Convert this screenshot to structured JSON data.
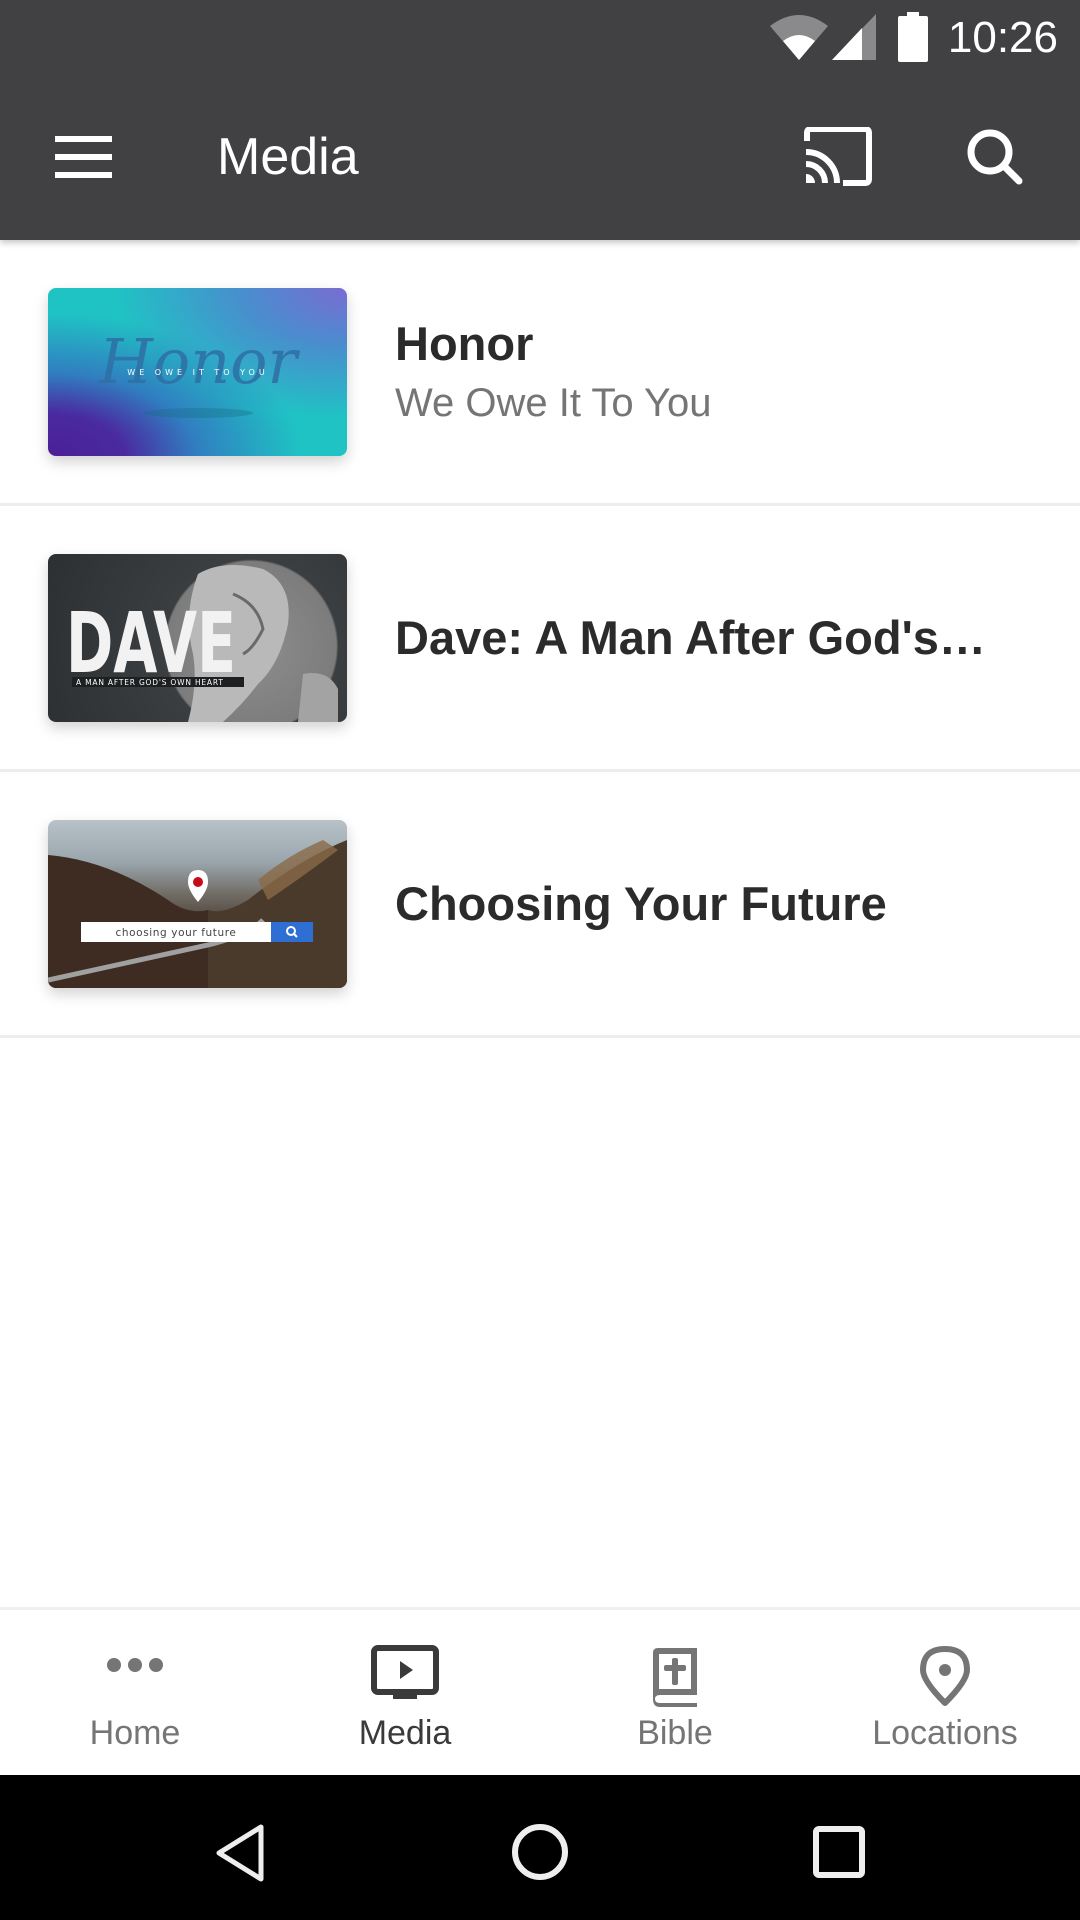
{
  "status_bar": {
    "time": "10:26",
    "icons": [
      "wifi-icon",
      "cell-signal-icon",
      "battery-icon"
    ]
  },
  "toolbar": {
    "title": "Media",
    "menu_icon": "hamburger-menu-icon",
    "actions": [
      {
        "name": "cast",
        "icon": "cast-icon"
      },
      {
        "name": "search",
        "icon": "search-icon"
      }
    ],
    "background_color": "#414143"
  },
  "media_list": [
    {
      "title": "Honor",
      "subtitle": "We Owe It To You",
      "thumbnail": {
        "main_text": "Honor",
        "sub_text": "WE OWE IT TO YOU"
      }
    },
    {
      "title": "Dave: A Man After God's…",
      "subtitle": "",
      "thumbnail": {
        "main_text": "DAVE",
        "sub_text": "A MAN AFTER GOD'S OWN HEART"
      }
    },
    {
      "title": "Choosing Your Future",
      "subtitle": "",
      "thumbnail": {
        "main_text": "choosing your future",
        "sub_text": ""
      }
    }
  ],
  "bottom_nav": {
    "items": [
      {
        "label": "Home",
        "icon": "more-dots-icon",
        "active": false
      },
      {
        "label": "Media",
        "icon": "tv-play-icon",
        "active": true
      },
      {
        "label": "Bible",
        "icon": "bible-icon",
        "active": false
      },
      {
        "label": "Locations",
        "icon": "location-pin-icon",
        "active": false
      }
    ],
    "active_color": "#3a3a3a",
    "inactive_color": "#757575"
  },
  "system_nav": {
    "buttons": [
      "back",
      "home",
      "recents"
    ]
  }
}
